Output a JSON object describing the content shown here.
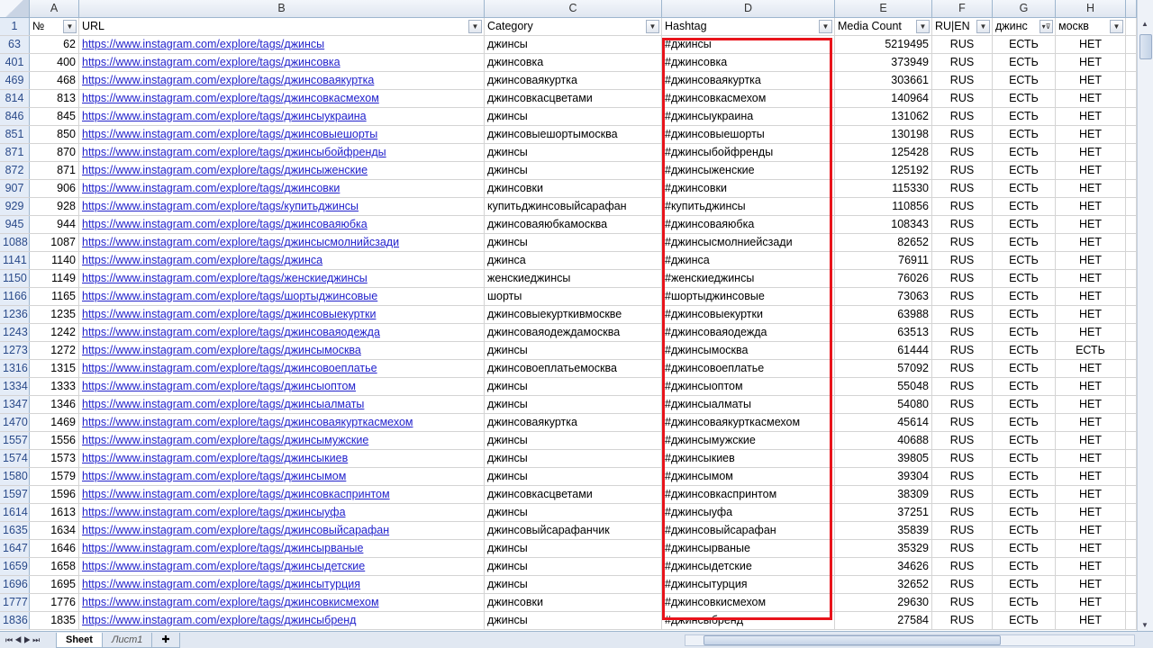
{
  "columns": [
    "A",
    "B",
    "C",
    "D",
    "E",
    "F",
    "G",
    "H"
  ],
  "header_row_number": "1",
  "headers": [
    "№",
    "URL",
    "Category",
    "Hashtag",
    "Media Count",
    "RU|EN",
    "джинс",
    "москв"
  ],
  "filtered_column": "G",
  "rows": [
    [
      "63",
      "62",
      "https://www.instagram.com/explore/tags/джинсы",
      "джинсы",
      "#джинсы",
      "5219495",
      "RUS",
      "ЕСТЬ",
      "НЕТ"
    ],
    [
      "401",
      "400",
      "https://www.instagram.com/explore/tags/джинсовка",
      "джинсовка",
      "#джинсовка",
      "373949",
      "RUS",
      "ЕСТЬ",
      "НЕТ"
    ],
    [
      "469",
      "468",
      "https://www.instagram.com/explore/tags/джинсоваякуртка",
      "джинсоваякуртка",
      "#джинсоваякуртка",
      "303661",
      "RUS",
      "ЕСТЬ",
      "НЕТ"
    ],
    [
      "814",
      "813",
      "https://www.instagram.com/explore/tags/джинсовкасмехом",
      "джинсовкасцветами",
      "#джинсовкасмехом",
      "140964",
      "RUS",
      "ЕСТЬ",
      "НЕТ"
    ],
    [
      "846",
      "845",
      "https://www.instagram.com/explore/tags/джинсыукраина",
      "джинсы",
      "#джинсыукраина",
      "131062",
      "RUS",
      "ЕСТЬ",
      "НЕТ"
    ],
    [
      "851",
      "850",
      "https://www.instagram.com/explore/tags/джинсовыешорты",
      "джинсовыешортымосква",
      "#джинсовыешорты",
      "130198",
      "RUS",
      "ЕСТЬ",
      "НЕТ"
    ],
    [
      "871",
      "870",
      "https://www.instagram.com/explore/tags/джинсыбойфренды",
      "джинсы",
      "#джинсыбойфренды",
      "125428",
      "RUS",
      "ЕСТЬ",
      "НЕТ"
    ],
    [
      "872",
      "871",
      "https://www.instagram.com/explore/tags/джинсыженские",
      "джинсы",
      "#джинсыженские",
      "125192",
      "RUS",
      "ЕСТЬ",
      "НЕТ"
    ],
    [
      "907",
      "906",
      "https://www.instagram.com/explore/tags/джинсовки",
      "джинсовки",
      "#джинсовки",
      "115330",
      "RUS",
      "ЕСТЬ",
      "НЕТ"
    ],
    [
      "929",
      "928",
      "https://www.instagram.com/explore/tags/купитьджинсы",
      "купитьджинсовыйсарафан",
      "#купитьджинсы",
      "110856",
      "RUS",
      "ЕСТЬ",
      "НЕТ"
    ],
    [
      "945",
      "944",
      "https://www.instagram.com/explore/tags/джинсоваяюбка",
      "джинсоваяюбкамосква",
      "#джинсоваяюбка",
      "108343",
      "RUS",
      "ЕСТЬ",
      "НЕТ"
    ],
    [
      "1088",
      "1087",
      "https://www.instagram.com/explore/tags/джинсысмолнийсзади",
      "джинсы",
      "#джинсысмолниейсзади",
      "82652",
      "RUS",
      "ЕСТЬ",
      "НЕТ"
    ],
    [
      "1141",
      "1140",
      "https://www.instagram.com/explore/tags/джинса",
      "джинса",
      "#джинса",
      "76911",
      "RUS",
      "ЕСТЬ",
      "НЕТ"
    ],
    [
      "1150",
      "1149",
      "https://www.instagram.com/explore/tags/женскиеджинсы",
      "женскиеджинсы",
      "#женскиеджинсы",
      "76026",
      "RUS",
      "ЕСТЬ",
      "НЕТ"
    ],
    [
      "1166",
      "1165",
      "https://www.instagram.com/explore/tags/шортыджинсовые",
      "шорты",
      "#шортыджинсовые",
      "73063",
      "RUS",
      "ЕСТЬ",
      "НЕТ"
    ],
    [
      "1236",
      "1235",
      "https://www.instagram.com/explore/tags/джинсовыекуртки",
      "джинсовыекурткивмоскве",
      "#джинсовыекуртки",
      "63988",
      "RUS",
      "ЕСТЬ",
      "НЕТ"
    ],
    [
      "1243",
      "1242",
      "https://www.instagram.com/explore/tags/джинсоваяодежда",
      "джинсоваяодеждамосква",
      "#джинсоваяодежда",
      "63513",
      "RUS",
      "ЕСТЬ",
      "НЕТ"
    ],
    [
      "1273",
      "1272",
      "https://www.instagram.com/explore/tags/джинсымосква",
      "джинсы",
      "#джинсымосква",
      "61444",
      "RUS",
      "ЕСТЬ",
      "ЕСТЬ"
    ],
    [
      "1316",
      "1315",
      "https://www.instagram.com/explore/tags/джинсовоеплатье",
      "джинсовоеплатьемосква",
      "#джинсовоеплатье",
      "57092",
      "RUS",
      "ЕСТЬ",
      "НЕТ"
    ],
    [
      "1334",
      "1333",
      "https://www.instagram.com/explore/tags/джинсыоптом",
      "джинсы",
      "#джинсыоптом",
      "55048",
      "RUS",
      "ЕСТЬ",
      "НЕТ"
    ],
    [
      "1347",
      "1346",
      "https://www.instagram.com/explore/tags/джинсыалматы",
      "джинсы",
      "#джинсыалматы",
      "54080",
      "RUS",
      "ЕСТЬ",
      "НЕТ"
    ],
    [
      "1470",
      "1469",
      "https://www.instagram.com/explore/tags/джинсоваякурткасмехом",
      "джинсоваякуртка",
      "#джинсоваякурткасмехом",
      "45614",
      "RUS",
      "ЕСТЬ",
      "НЕТ"
    ],
    [
      "1557",
      "1556",
      "https://www.instagram.com/explore/tags/джинсымужские",
      "джинсы",
      "#джинсымужские",
      "40688",
      "RUS",
      "ЕСТЬ",
      "НЕТ"
    ],
    [
      "1574",
      "1573",
      "https://www.instagram.com/explore/tags/джинсыкиев",
      "джинсы",
      "#джинсыкиев",
      "39805",
      "RUS",
      "ЕСТЬ",
      "НЕТ"
    ],
    [
      "1580",
      "1579",
      "https://www.instagram.com/explore/tags/джинсымом",
      "джинсы",
      "#джинсымом",
      "39304",
      "RUS",
      "ЕСТЬ",
      "НЕТ"
    ],
    [
      "1597",
      "1596",
      "https://www.instagram.com/explore/tags/джинсовкаспринтом",
      "джинсовкасцветами",
      "#джинсовкаспринтом",
      "38309",
      "RUS",
      "ЕСТЬ",
      "НЕТ"
    ],
    [
      "1614",
      "1613",
      "https://www.instagram.com/explore/tags/джинсыуфа",
      "джинсы",
      "#джинсыуфа",
      "37251",
      "RUS",
      "ЕСТЬ",
      "НЕТ"
    ],
    [
      "1635",
      "1634",
      "https://www.instagram.com/explore/tags/джинсовыйсарафан",
      "джинсовыйсарафанчик",
      "#джинсовыйсарафан",
      "35839",
      "RUS",
      "ЕСТЬ",
      "НЕТ"
    ],
    [
      "1647",
      "1646",
      "https://www.instagram.com/explore/tags/джинсырваные",
      "джинсы",
      "#джинсырваные",
      "35329",
      "RUS",
      "ЕСТЬ",
      "НЕТ"
    ],
    [
      "1659",
      "1658",
      "https://www.instagram.com/explore/tags/джинсыдетские",
      "джинсы",
      "#джинсыдетские",
      "34626",
      "RUS",
      "ЕСТЬ",
      "НЕТ"
    ],
    [
      "1696",
      "1695",
      "https://www.instagram.com/explore/tags/джинсытурция",
      "джинсы",
      "#джинсытурция",
      "32652",
      "RUS",
      "ЕСТЬ",
      "НЕТ"
    ],
    [
      "1777",
      "1776",
      "https://www.instagram.com/explore/tags/джинсовкисмехом",
      "джинсовки",
      "#джинсовкисмехом",
      "29630",
      "RUS",
      "ЕСТЬ",
      "НЕТ"
    ],
    [
      "1836",
      "1835",
      "https://www.instagram.com/explore/tags/джинсыбренд",
      "джинсы",
      "#джинсыбренд",
      "27584",
      "RUS",
      "ЕСТЬ",
      "НЕТ"
    ]
  ],
  "sheet_tabs": [
    "Sheet",
    "Лист1"
  ],
  "active_tab": "Sheet",
  "highlight_color": "#e8131b"
}
